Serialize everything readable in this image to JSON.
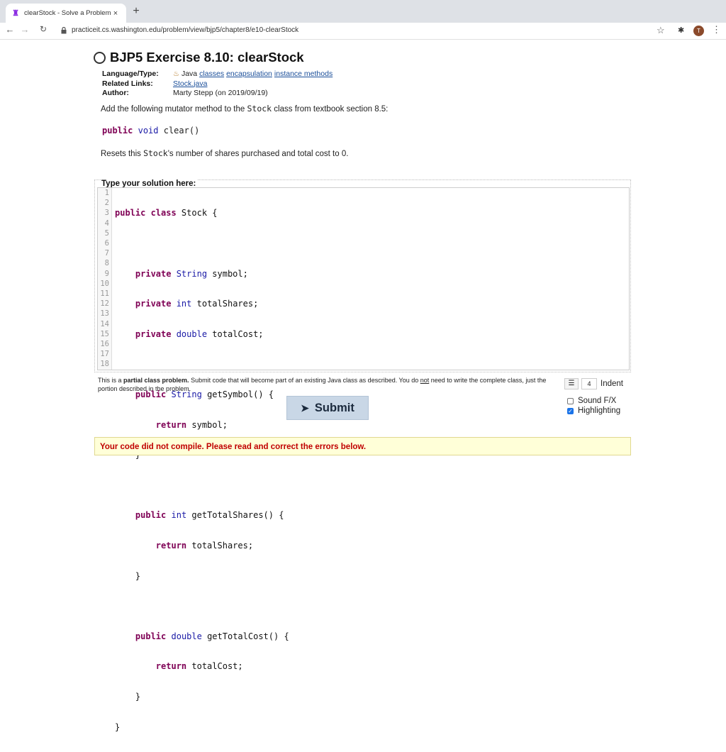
{
  "browser": {
    "tab_title": "clearStock - Solve a Problem -",
    "tab_close": "×",
    "new_tab": "+",
    "url": "practiceit.cs.washington.edu/problem/view/bjp5/chapter8/e10-clearStock",
    "profile_initial": "T"
  },
  "page": {
    "title": "BJP5 Exercise 8.10: clearStock",
    "meta": {
      "language_key": "Language/Type:",
      "language_prefix": "Java",
      "language_links": [
        "classes",
        "encapsulation",
        "instance methods"
      ],
      "related_key": "Related Links:",
      "related_link": "Stock.java",
      "author_key": "Author:",
      "author_val": "Marty Stepp (on 2019/09/19)"
    },
    "description": {
      "pre": "Add the following mutator method to the ",
      "class_name": "Stock",
      "post": " class from textbook section 8.5:"
    },
    "signature": {
      "kw1": "public",
      "kw2": "void",
      "name": "clear()"
    },
    "description2": {
      "pre": "Resets this ",
      "class_name": "Stock",
      "post": "'s number of shares purchased and total cost to 0."
    },
    "solution_label": "Type your solution here:",
    "line_numbers": [
      "1",
      "2",
      "3",
      "4",
      "5",
      "6",
      "7",
      "8",
      "9",
      "10",
      "11",
      "12",
      "13",
      "14",
      "15",
      "16",
      "17",
      "18"
    ],
    "code": {
      "l1": {
        "k": "public class",
        "r": " Stock {"
      },
      "l3": {
        "k": "private",
        "t": " String",
        "r": " symbol;"
      },
      "l4": {
        "k": "private",
        "t": " int",
        "r": " totalShares;"
      },
      "l5": {
        "k": "private",
        "t": " double",
        "r": " totalCost;"
      },
      "l7": {
        "k": "public",
        "t": " String",
        "r": " getSymbol() {"
      },
      "l8": {
        "k": "return",
        "r": " symbol;"
      },
      "l9": {
        "r": "}"
      },
      "l11": {
        "k": "public",
        "t": " int",
        "r": " getTotalShares() {"
      },
      "l12": {
        "k": "return",
        "r": " totalShares;"
      },
      "l13": {
        "r": "}"
      },
      "l15": {
        "k": "public",
        "t": " double",
        "r": " getTotalCost() {"
      },
      "l16": {
        "k": "return",
        "r": " totalCost;"
      },
      "l17": {
        "r": "}"
      },
      "l18": {
        "r": "}"
      }
    },
    "partial_note": {
      "pre": "This is a ",
      "bold": "partial class problem.",
      "mid": " Submit code that will become part of an existing Java class as described. You do ",
      "underline": "not",
      "post": " need to write the complete class, just the portion described in the problem."
    },
    "indent_value": "4",
    "indent_label": "Indent",
    "sound_label": "Sound F/X",
    "highlight_label": "Highlighting",
    "submit_label": "Submit",
    "error_message": "Your code did not compile. Please read and correct the errors below."
  }
}
